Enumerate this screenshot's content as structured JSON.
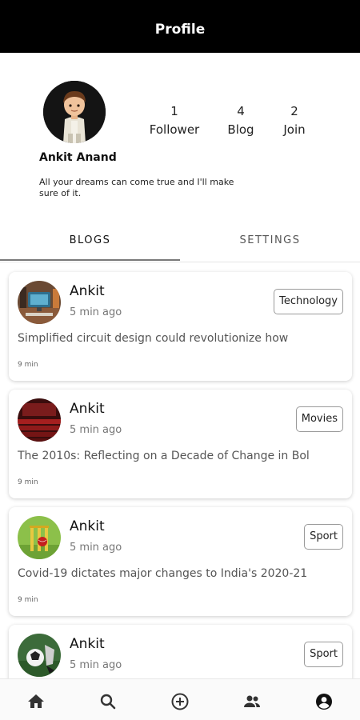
{
  "appbar": {
    "title": "Profile"
  },
  "profile": {
    "name": "Ankit Anand",
    "bio": "All your dreams can come true and I'll make sure of it.",
    "stats": [
      {
        "value": "1",
        "label": "Follower"
      },
      {
        "value": "4",
        "label": "Blog"
      },
      {
        "value": "2",
        "label": "Join"
      }
    ]
  },
  "tabs": [
    {
      "label": "BLOGS",
      "active": true
    },
    {
      "label": "SETTINGS",
      "active": false
    }
  ],
  "posts": [
    {
      "author": "Ankit",
      "time": "5 min ago",
      "tag": "Technology",
      "title": "Simplified circuit design could revolutionize how",
      "read_time": "9 min",
      "thumb_icon": "computer-thumbnail"
    },
    {
      "author": "Ankit",
      "time": "5 min ago",
      "tag": "Movies",
      "title": "The 2010s: Reflecting on a Decade of Change in Bol",
      "read_time": "9 min",
      "thumb_icon": "cinema-thumbnail"
    },
    {
      "author": "Ankit",
      "time": "5 min ago",
      "tag": "Sport",
      "title": "Covid-19 dictates major changes to India's 2020-21",
      "read_time": "9 min",
      "thumb_icon": "cricket-thumbnail"
    },
    {
      "author": "Ankit",
      "time": "5 min ago",
      "tag": "Sport",
      "title": "",
      "read_time": "",
      "thumb_icon": "football-thumbnail"
    }
  ],
  "bottom_nav": [
    {
      "icon": "home-icon"
    },
    {
      "icon": "search-icon"
    },
    {
      "icon": "add-circle-icon"
    },
    {
      "icon": "people-icon"
    },
    {
      "icon": "account-circle-icon"
    }
  ]
}
